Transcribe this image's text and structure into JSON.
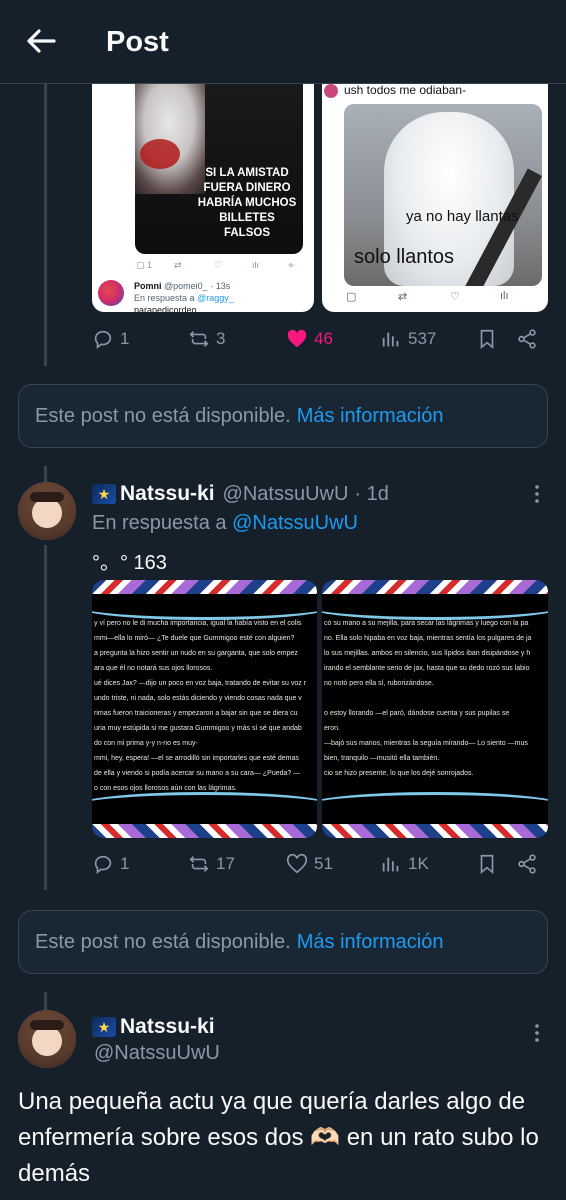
{
  "header": {
    "title": "Post"
  },
  "post_top": {
    "media_left": {
      "meme_text_line1": "SI LA AMISTAD",
      "meme_text_line2": "FUERA DINERO",
      "meme_text_line3": "HABRÍA MUCHOS",
      "meme_text_line4": "BILLETES FALSOS",
      "mini_replies": "1",
      "reply_name": "Pomni",
      "reply_handle": "@pomei0_ · 13s",
      "reply_to_prefix": "En respuesta a",
      "reply_to_handle": "@raggy_",
      "reply_snippet": "parapedicordeo"
    },
    "media_right": {
      "caption_top": "ush todos me odiaban-",
      "overlay1": "ya no hay llantas",
      "overlay2": "solo llantos"
    },
    "actions": {
      "replies": "1",
      "reposts": "3",
      "likes": "46",
      "views": "537"
    }
  },
  "unavailable_1": {
    "text": "Este post no está disponible.",
    "link": "Más información"
  },
  "post_mid": {
    "name": "Natssu-ki",
    "handle": "@NatssuUwU",
    "time": "· 1d",
    "reply_prefix": "En respuesta a",
    "reply_handle": "@NatssuUwU",
    "body": "°。° 163",
    "img_left_lines": [
      "y ví pero no le di mucha importancia, igual la había visto en el colis",
      "mmi—ella lo miró— ¿Te duele que Gummigoo esté con alguien?",
      "a pregunta la hizo sentir un nudo en su garganta, que solo empez",
      "ara que él no notará sus ojos llorosos.",
      "ué dices Jax? —dijo un poco en voz baja, tratando de evitar su voz r",
      "undo triste, ni nada, solo estás diciendo y viendo cosas nada que v",
      "rimas fueron traicioneras y empezaron a bajar sin que se diera cu",
      "uria muy estúpida si me gustara Gummigoo y más sí sé que andab",
      "do con mi prima y-y n-no es muy-",
      "mmi, hey, espera! —el se arrodilló sin importarles que esté demas",
      "de ella y viendo si podía acercar su mano a su cara— ¿Pueda? —",
      "o con esos ojos llorosos aún con las lágrimas."
    ],
    "img_right_lines": [
      "có su mano a su mejilla, para secar las lágrimas y luego con la pa",
      "no. Ella solo hipaba en voz baja, mientras sentía los pulgares de ja",
      "lo sus mejillas. ambos en silencio, sus lípidos iban disipándose y h",
      "irando el semblante serio de jax, hasta que su dedo rozó sus labio",
      "no notó pero ella sí, ruborizándose.",
      "o estoy llorando —el paró, dándose cuenta y sus pupilas se",
      "eron.",
      "—bajó sus manos, mientras la seguía mirando— Lo siento —mus",
      "bien, tranquilo —musitó ella también.",
      "cio se hizo presente, lo que los dejé sonrojados."
    ],
    "actions": {
      "replies": "1",
      "reposts": "17",
      "likes": "51",
      "views": "1K"
    }
  },
  "unavailable_2": {
    "text": "Este post no está disponible.",
    "link": "Más información"
  },
  "post_main": {
    "name": "Natssu-ki",
    "handle": "@NatssuUwU",
    "body": "Una pequeña actu ya que quería darles algo de enfermería sobre esos dos 🫶🏻 en un rato subo lo demás"
  },
  "colors": {
    "background": "#15202b",
    "accent": "#1d9bf0",
    "like_active": "#f91880",
    "muted": "#8b98a5",
    "border": "#38444d"
  }
}
